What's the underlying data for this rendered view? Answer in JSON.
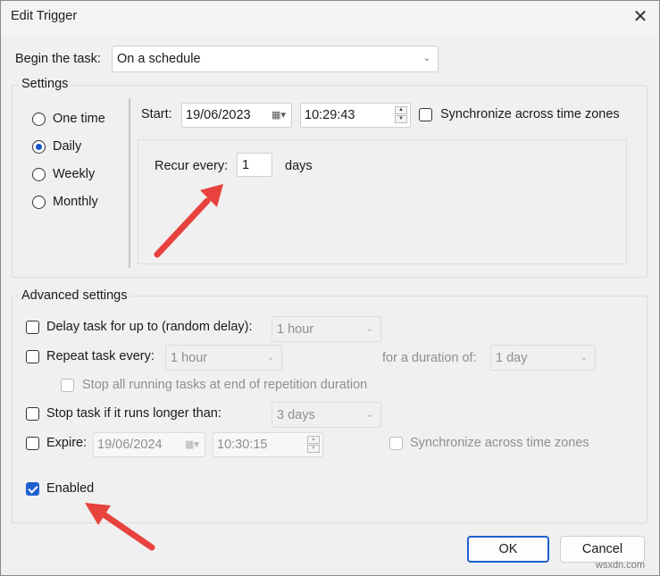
{
  "window": {
    "title": "Edit Trigger",
    "close_glyph": "✕"
  },
  "begin": {
    "label": "Begin the task:",
    "value": "On a schedule"
  },
  "settings": {
    "legend": "Settings",
    "schedule_options": [
      "One time",
      "Daily",
      "Weekly",
      "Monthly"
    ],
    "selected_option": "Daily",
    "start_label": "Start:",
    "start_date": "19/06/2023",
    "start_time": "10:29:43",
    "sync_label": "Synchronize across time zones",
    "recur_label": "Recur every:",
    "recur_value": "1",
    "recur_unit": "days"
  },
  "advanced": {
    "legend": "Advanced settings",
    "delay_label": "Delay task for up to (random delay):",
    "delay_value": "1 hour",
    "repeat_label": "Repeat task every:",
    "repeat_value": "1 hour",
    "duration_label": "for a duration of:",
    "duration_value": "1 day",
    "stop_running_label": "Stop all running tasks at end of repetition duration",
    "stop_longer_label": "Stop task if it runs longer than:",
    "stop_longer_value": "3 days",
    "expire_label": "Expire:",
    "expire_date": "19/06/2024",
    "expire_time": "10:30:15",
    "expire_sync_label": "Synchronize across time zones",
    "enabled_label": "Enabled",
    "enabled_checked": true
  },
  "buttons": {
    "ok": "OK",
    "cancel": "Cancel"
  },
  "annotations": {
    "arrow_color": "#e8423f"
  },
  "watermark": "wsxdn.com",
  "icons": {
    "calendar": "▦▾",
    "spin_up": "▲",
    "spin_down": "▼",
    "chevron": "⌄"
  }
}
